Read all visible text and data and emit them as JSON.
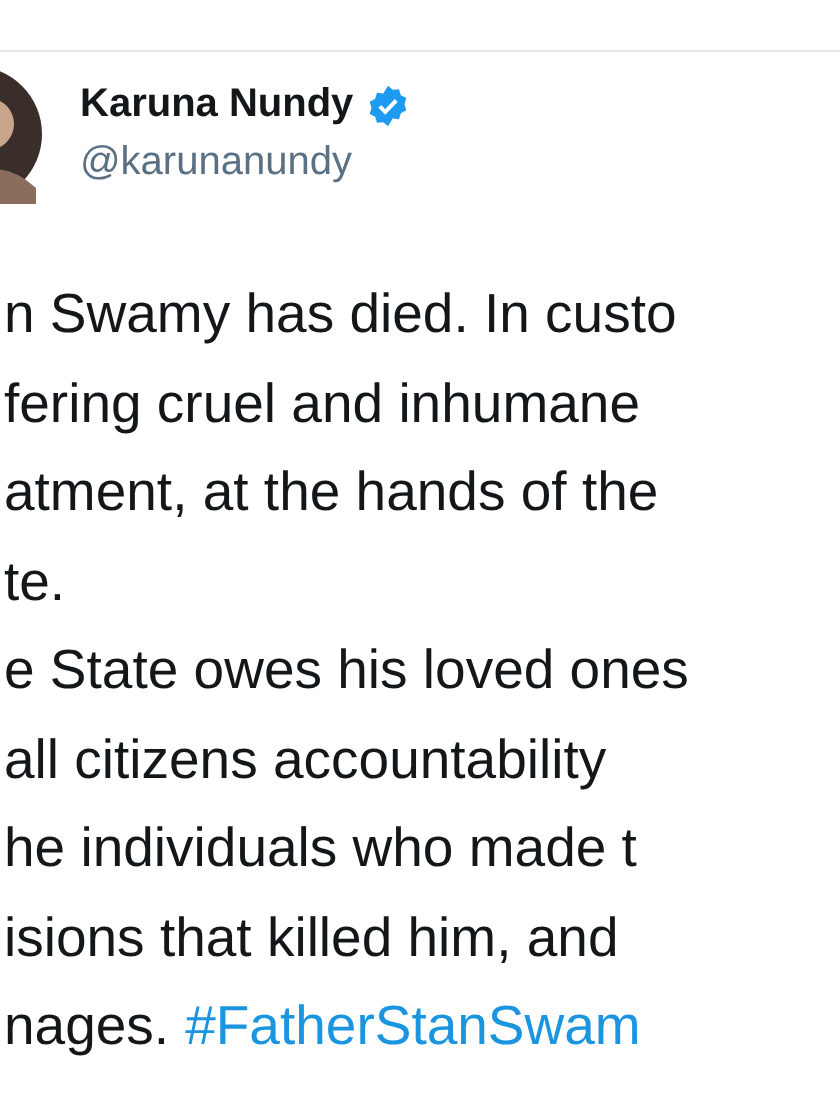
{
  "author": {
    "name": "Karuna Nundy",
    "verified": true,
    "handle": "@karunanundy"
  },
  "tweet_lines": [
    {
      "text": "n Swamy has died. In custo"
    },
    {
      "text": "fering cruel and inhumane"
    },
    {
      "text": "atment, at the hands of the"
    },
    {
      "text": "te."
    },
    {
      "text": "e State owes his loved ones"
    },
    {
      "text": "all citizens accountability"
    },
    {
      "text": "he individuals who made t"
    },
    {
      "text": "isions that killed him, and"
    },
    {
      "text": "nages.",
      "hashtag": "#FatherStanSwam"
    }
  ]
}
